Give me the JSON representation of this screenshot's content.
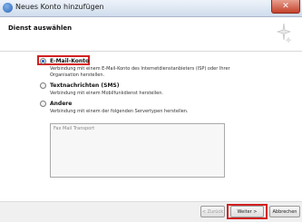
{
  "window": {
    "title": "Neues Konto hinzufügen",
    "close_label": "✕"
  },
  "header": {
    "title": "Dienst auswählen"
  },
  "options": [
    {
      "label": "E-Mail-Konto",
      "description": "Verbindung mit einem E-Mail-Konto des Internetdienstanbieters (ISP) oder Ihrer Organisation herstellen.",
      "selected": true
    },
    {
      "label": "Textnachrichten (SMS)",
      "description": "Verbindung mit einem Mobilfunkdienst herstellen.",
      "selected": false
    },
    {
      "label": "Andere",
      "description": "Verbindung mit einem der folgenden Servertypen herstellen.",
      "selected": false
    }
  ],
  "server_types": {
    "items": [
      "Fax Mail Transport"
    ]
  },
  "footer": {
    "back_label": "< Zurück",
    "next_label": "Weiter >",
    "cancel_label": "Abbrechen"
  },
  "colors": {
    "highlight": "#d32020",
    "radio_selected": "#1f57c3"
  }
}
